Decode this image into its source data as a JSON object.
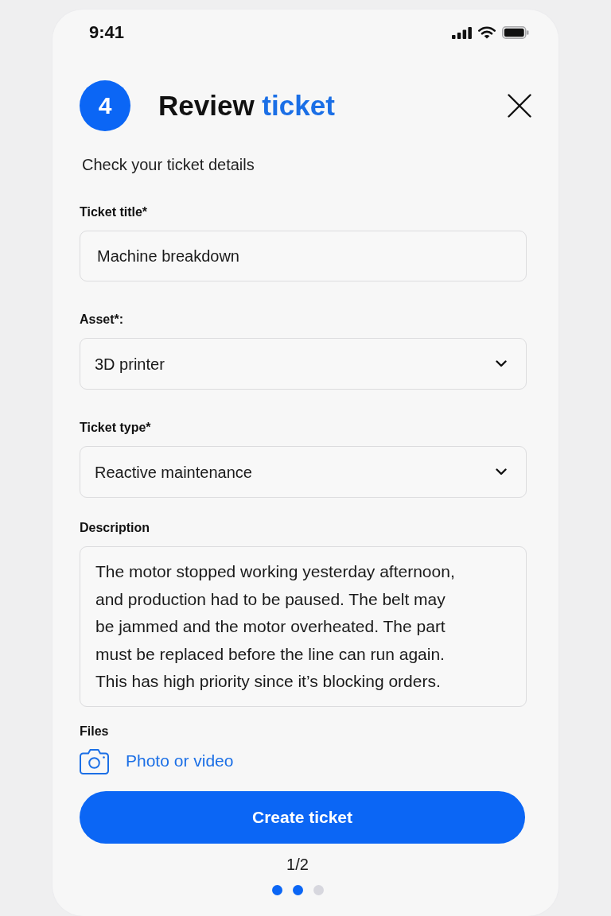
{
  "status_bar": {
    "time": "9:41"
  },
  "header": {
    "step": "4",
    "title": [
      {
        "text": "Review",
        "accent": false
      },
      {
        "text": "ticket",
        "accent": true
      }
    ],
    "subtitle": "Check your ticket details"
  },
  "fields": [
    {
      "kind": "text",
      "label": "Ticket title*",
      "value": "Machine breakdown"
    },
    {
      "kind": "select",
      "label": "Asset*:",
      "value": "3D printer"
    },
    {
      "kind": "select",
      "label": "Ticket type*",
      "value": "Reactive maintenance"
    },
    {
      "kind": "textarea",
      "label": "Description",
      "value": "The motor stopped working yesterday afternoon, and production had to be paused. The belt may be jammed and the motor overheated. The part must be replaced before the line can run again. This has high priority since it’s blocking orders."
    }
  ],
  "files": {
    "label": "Files",
    "action": "Photo or video"
  },
  "submit_button": "Create ticket",
  "pager": {
    "text": "1/2",
    "dots": [
      {
        "active": true
      },
      {
        "active": true
      },
      {
        "active": false
      }
    ]
  }
}
